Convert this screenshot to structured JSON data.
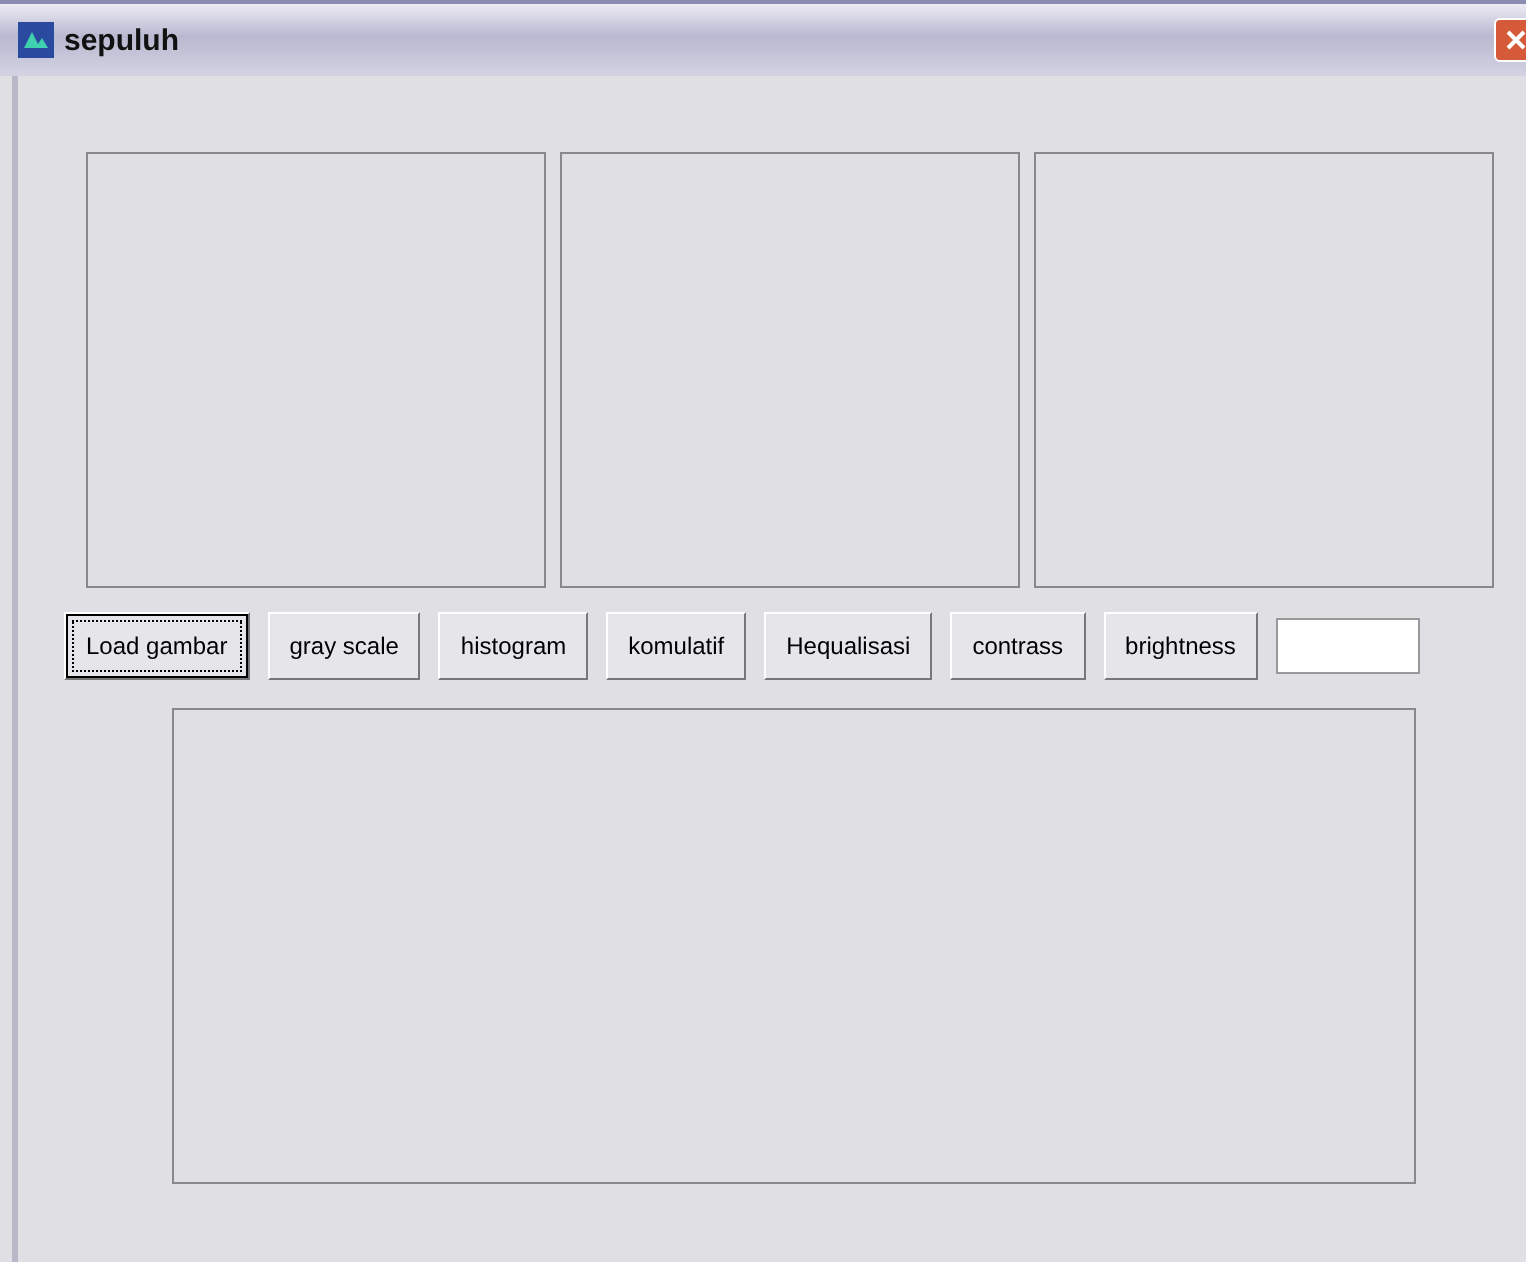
{
  "window": {
    "title": "sepuluh"
  },
  "buttons": [
    {
      "label": "Load gambar",
      "focused": true
    },
    {
      "label": "gray scale",
      "focused": false
    },
    {
      "label": "histogram",
      "focused": false
    },
    {
      "label": "komulatif",
      "focused": false
    },
    {
      "label": "Hequalisasi",
      "focused": false
    },
    {
      "label": "contrass",
      "focused": false
    },
    {
      "label": "brightness",
      "focused": false
    }
  ]
}
